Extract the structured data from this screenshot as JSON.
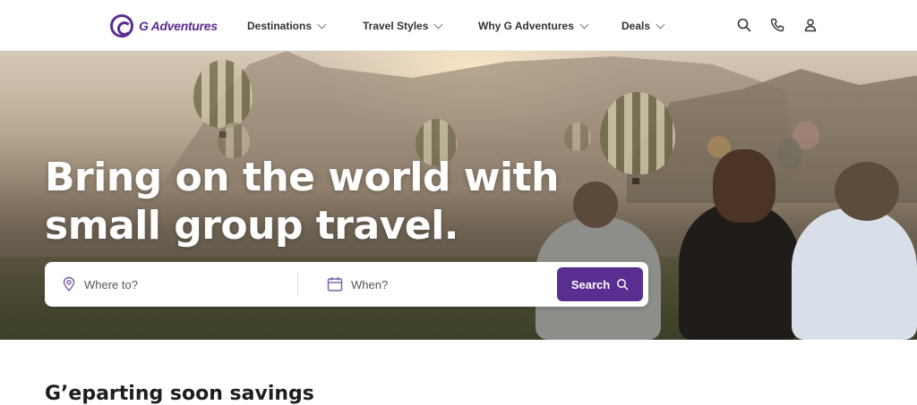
{
  "header": {
    "logo_text": "G Adventures",
    "nav": [
      {
        "label": "Destinations"
      },
      {
        "label": "Travel Styles"
      },
      {
        "label": "Why G Adventures"
      },
      {
        "label": "Deals"
      }
    ],
    "icons": [
      "search-icon",
      "phone-icon",
      "user-icon"
    ]
  },
  "hero": {
    "title_line1": "Bring on the world with",
    "title_line2": "small group travel."
  },
  "search": {
    "where_placeholder": "Where to?",
    "when_placeholder": "When?",
    "button_label": "Search"
  },
  "section": {
    "title": "G’eparting soon savings"
  },
  "colors": {
    "brand": "#5a2d91"
  }
}
